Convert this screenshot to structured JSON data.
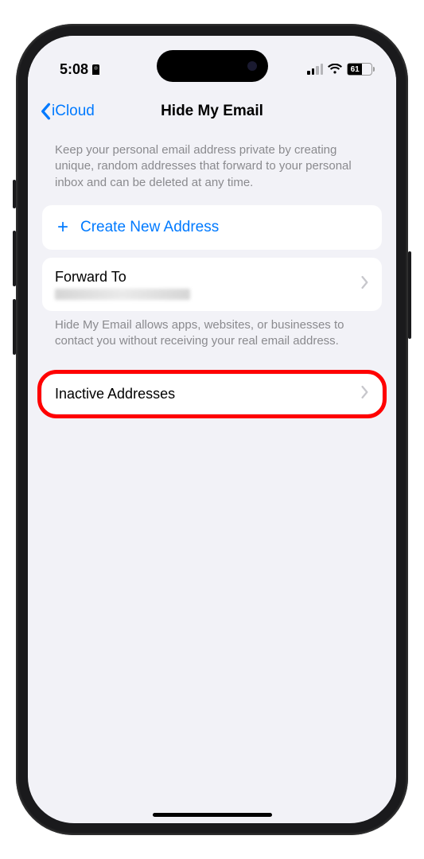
{
  "status": {
    "time": "5:08",
    "battery_pct": "61"
  },
  "nav": {
    "back_label": "iCloud",
    "title": "Hide My Email"
  },
  "main": {
    "description": "Keep your personal email address private by creating unique, random addresses that forward to your personal inbox and can be deleted at any time.",
    "create_label": "Create New Address",
    "forward_title": "Forward To",
    "forward_footer": "Hide My Email allows apps, websites, or businesses to contact you without receiving your real email address.",
    "inactive_label": "Inactive Addresses"
  }
}
